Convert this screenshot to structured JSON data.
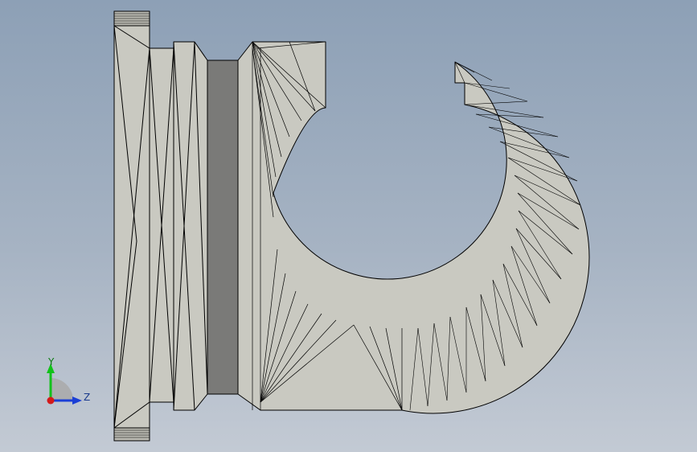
{
  "viewport": {
    "background_top": "#8da0b6",
    "background_bottom": "#c3cad4"
  },
  "model": {
    "face_color": "#c9c9c1",
    "dark_face_color": "#7a7a78",
    "edge_color": "#000000"
  },
  "triad": {
    "y_label": "Y",
    "z_label": "Z",
    "y_color": "#12c21a",
    "z_color": "#1b3fd6",
    "origin_color": "#d41a1a"
  }
}
